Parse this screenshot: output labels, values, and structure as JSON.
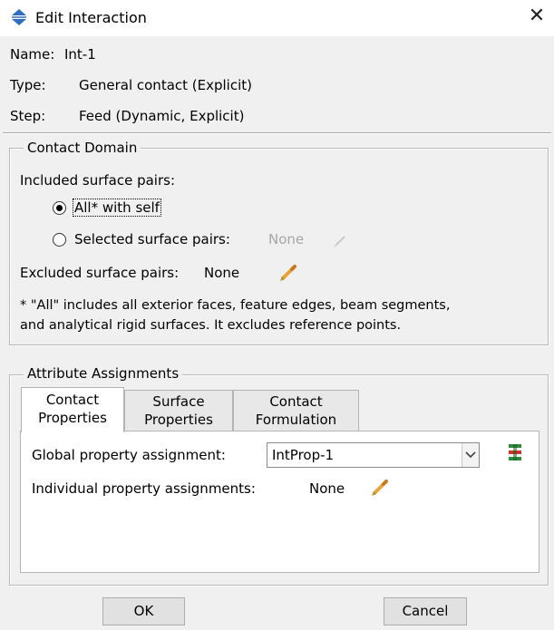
{
  "window": {
    "title": "Edit Interaction",
    "close_glyph": "✕",
    "icon": "interaction-diamond-icon"
  },
  "info": {
    "name_label": "Name:",
    "name_value": "Int-1",
    "type_label": "Type:",
    "type_value": "General contact (Explicit)",
    "step_label": "Step:",
    "step_value": "Feed (Dynamic, Explicit)"
  },
  "contact_domain": {
    "title": "Contact Domain",
    "included_label": "Included surface pairs:",
    "option_all": "All* with self",
    "option_selected": "Selected surface pairs:",
    "selected_value": "None",
    "selected_option": "all",
    "excluded_label": "Excluded surface pairs:",
    "excluded_value": "None",
    "note_line1": "* \"All\" includes all exterior faces, feature edges, beam segments,",
    "note_line2": "and analytical rigid surfaces. It excludes reference points."
  },
  "attribute_assignments": {
    "title": "Attribute Assignments",
    "tabs": [
      {
        "line1": "Contact",
        "line2": "Properties"
      },
      {
        "line1": "Surface",
        "line2": "Properties"
      },
      {
        "line1": "Contact",
        "line2": "Formulation"
      }
    ],
    "active_tab": 0,
    "global_label": "Global property assignment:",
    "global_value": "IntProp-1",
    "individual_label": "Individual property assignments:",
    "individual_value": "None"
  },
  "buttons": {
    "ok": "OK",
    "cancel": "Cancel"
  },
  "colors": {
    "panel_bg": "#f0f0f0",
    "icon_blue": "#2f6fbf",
    "pencil_orange": "#e8a33a",
    "manager_icon_green": "#2a8c3a",
    "manager_icon_red": "#d2302c"
  }
}
